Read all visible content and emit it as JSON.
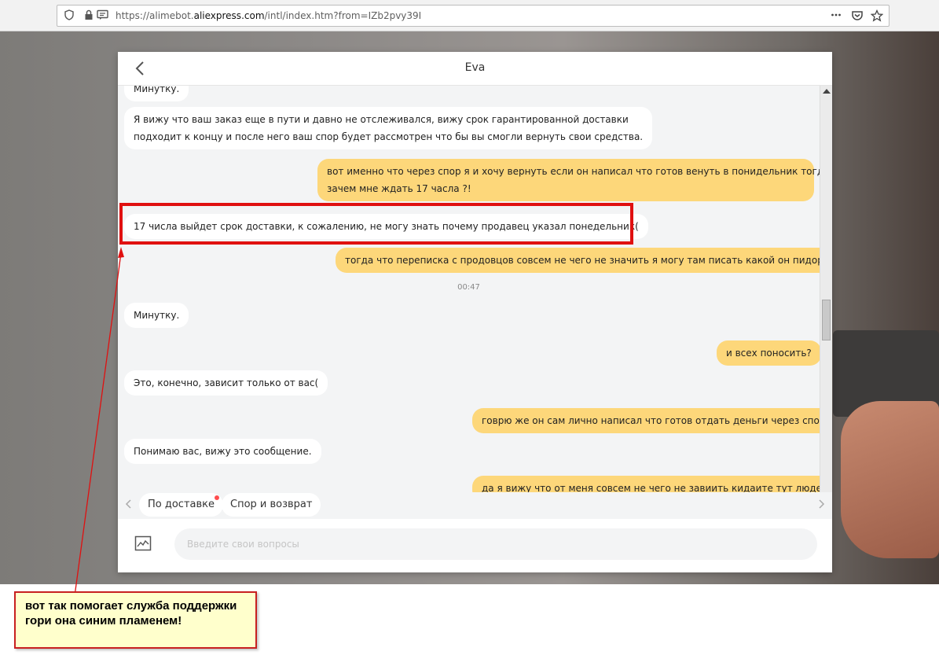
{
  "browser": {
    "url_prefix": "https://alimebot.",
    "url_domain": "aliexpress.com",
    "url_suffix": "/intl/index.htm?from=IZb2pvy39I",
    "more_icon": "ellipsis-icon",
    "pocket_icon": "pocket-icon",
    "bookmark_icon": "star-icon"
  },
  "chat": {
    "title": "Eva",
    "time_label": "00:47",
    "messages": [
      {
        "side": "in",
        "text": "Минутку."
      },
      {
        "side": "in",
        "line1": "Я вижу что ваш заказ еще в пути и давно не отслеживался, вижу срок гарантированной доставки",
        "line2": "подходит к концу и после него ваш спор будет рассмотрен что бы вы смогли вернуть свои средства."
      },
      {
        "side": "out",
        "line1": "вот именно что через спор я и хочу вернуть если он написал что готов венуть в понидельник тогда",
        "line2": "зачем мне ждать 17 часла ?!"
      },
      {
        "side": "in",
        "text": "17 числа выйдет срок доставки, к сожалению, не могу знать почему продавец указал понедельник("
      },
      {
        "side": "out",
        "text": "тогда что переписка с продовцов совсем не чего не значить я могу там писать какой он пидор?!"
      },
      {
        "side": "in",
        "text": "Минутку."
      },
      {
        "side": "out",
        "text": "и всех поносить?"
      },
      {
        "side": "in",
        "text": "Это, конечно, зависит только от вас("
      },
      {
        "side": "out",
        "text": "говрю же он сам лично написал что готов отдать деньги через спор"
      },
      {
        "side": "in",
        "text": "Понимаю вас, вижу это сообщение."
      },
      {
        "side": "out",
        "text": "да я вижу что от меня совсем не чего не завиить кидаите тут людей"
      }
    ],
    "quick_replies": [
      "По доставке",
      "Спор и возврат"
    ],
    "input_placeholder": "Введите свои вопросы"
  },
  "annotation": {
    "text": "вот так помогает служба поддержки гори она синим пламенем!",
    "border_color": "#e01010"
  },
  "colors": {
    "outgoing_bubble": "#fdd77a",
    "incoming_bubble": "#ffffff",
    "chat_background": "#f3f4f5"
  }
}
